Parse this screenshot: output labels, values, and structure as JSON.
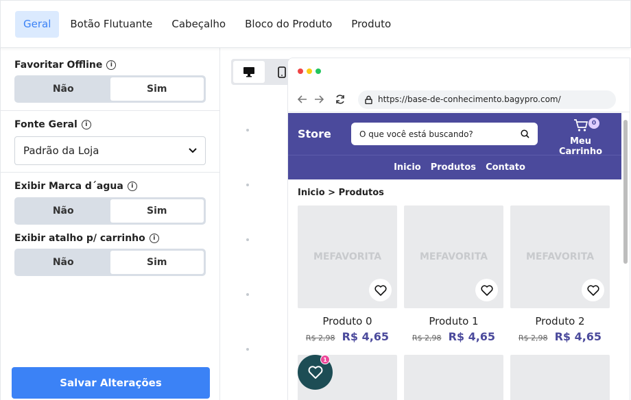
{
  "tabs": [
    {
      "label": "Geral"
    },
    {
      "label": "Botão Flutuante"
    },
    {
      "label": "Cabeçalho"
    },
    {
      "label": "Bloco do Produto"
    },
    {
      "label": "Produto"
    }
  ],
  "settings": {
    "favoritar_offline": {
      "label": "Favoritar Offline",
      "option_no": "Não",
      "option_yes": "Sim",
      "selected": "Sim"
    },
    "fonte_geral": {
      "label": "Fonte Geral",
      "value": "Padrão da Loja"
    },
    "exibir_marca": {
      "label": "Exibir Marca d´agua",
      "option_no": "Não",
      "option_yes": "Sim",
      "selected": "Sim"
    },
    "exibir_atalho": {
      "label": "Exibir atalho p/ carrinho",
      "option_no": "Não",
      "option_yes": "Sim",
      "selected": "Sim"
    }
  },
  "save_button": "Salvar Alterações",
  "preview": {
    "url": "https://base-de-conhecimento.bagypro.com/",
    "store_name": "Store",
    "search_placeholder": "O que você está buscando?",
    "cart_label": "Meu Carrinho",
    "cart_count": "0",
    "menu": [
      "Inicio",
      "Produtos",
      "Contato"
    ],
    "breadcrumb": "Inicio > Produtos",
    "watermark": "MEFAVORITA",
    "products": [
      {
        "name": "Produto 0",
        "old_price": "R$ 2,98",
        "price": "R$ 4,65"
      },
      {
        "name": "Produto 1",
        "old_price": "R$ 2,98",
        "price": "R$ 4,65"
      },
      {
        "name": "Produto 2",
        "old_price": "R$ 2,98",
        "price": "R$ 4,65"
      }
    ],
    "floating_badge": "1"
  },
  "colors": {
    "accent": "#3b82f6",
    "store_primary": "#4b4a9c",
    "floating_button": "#1d4d55"
  }
}
